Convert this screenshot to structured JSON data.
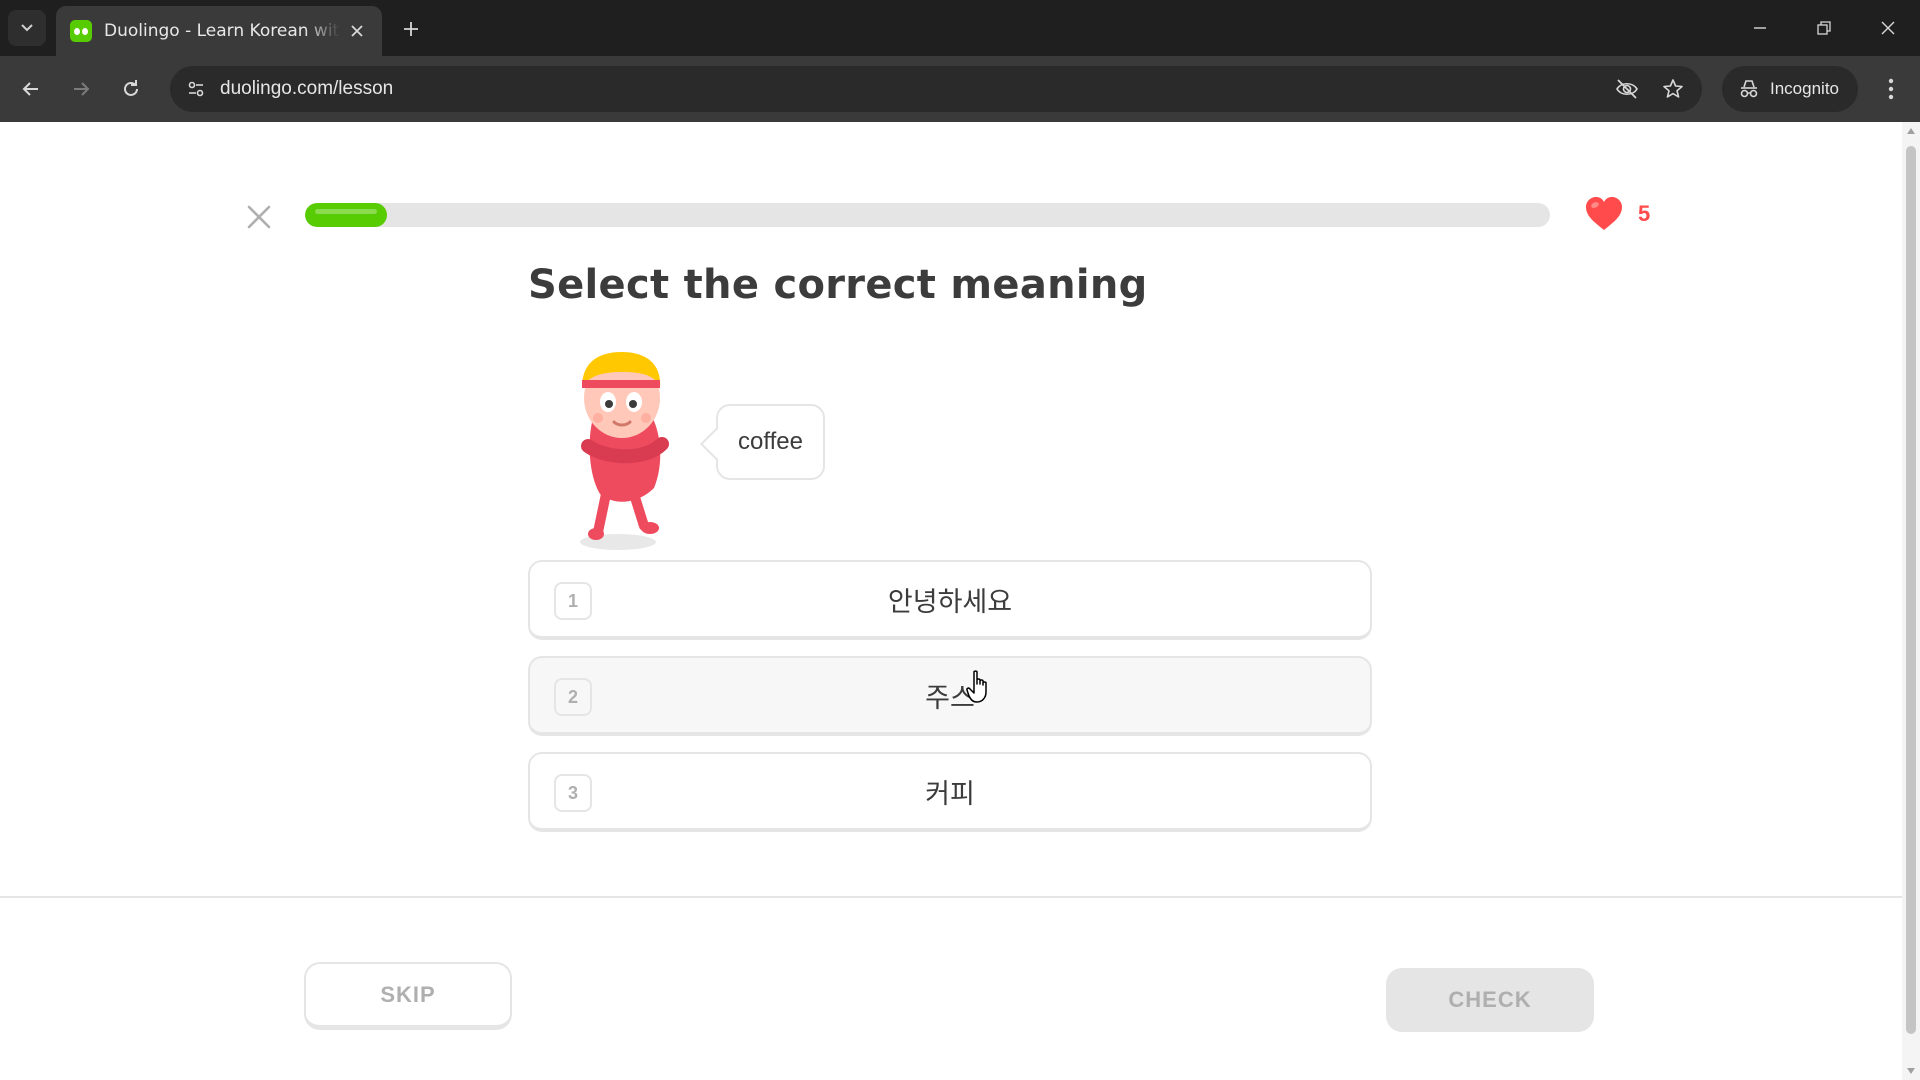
{
  "browser": {
    "tab_title": "Duolingo - Learn Korean with lessons",
    "url": "duolingo.com/lesson",
    "incognito_label": "Incognito"
  },
  "lesson": {
    "progress": 0.066,
    "hearts": "5",
    "prompt": "Select the correct meaning",
    "bubble_word": "coffee",
    "choices": [
      {
        "num": "1",
        "text": "안녕하세요"
      },
      {
        "num": "2",
        "text": "주스"
      },
      {
        "num": "3",
        "text": "커피"
      }
    ],
    "skip_label": "SKIP",
    "check_label": "CHECK"
  },
  "colors": {
    "brand_green": "#58cc02",
    "heart_red": "#ff4b4b",
    "border_gray": "#e5e5e5",
    "text_dark": "#3c3c3c"
  },
  "icons": [
    "tab-search-icon",
    "duolingo-favicon",
    "close-icon",
    "plus-icon",
    "minimize-icon",
    "restore-icon",
    "back-icon",
    "forward-icon",
    "reload-icon",
    "site-info-icon",
    "eye-off-icon",
    "star-icon",
    "incognito-icon",
    "more-icon",
    "heart-icon",
    "pointer-cursor-icon"
  ]
}
